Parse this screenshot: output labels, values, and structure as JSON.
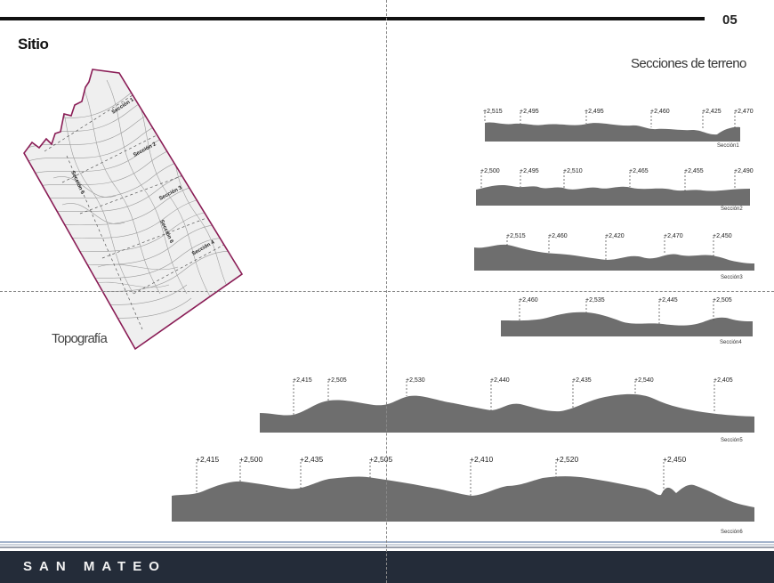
{
  "page_number": "05",
  "title": "Sitio",
  "sections_title": "Secciones de terreno",
  "topography_label": "Topografía",
  "footer": {
    "brand": "SAN MATEO",
    "color": "#242c39"
  },
  "colors": {
    "profile_fill": "#6e6e6e",
    "map_border": "#8a1d56",
    "rule": "#111111"
  },
  "map": {
    "labels": [
      "Sección 1",
      "Sección 2",
      "Sección 3",
      "Sección 4",
      "Sección 5",
      "Sección 6"
    ]
  },
  "profiles": [
    {
      "name": "Sección1",
      "elevations": [
        "+2,515",
        "+2,495",
        "+2,495",
        "+2,460",
        "+2,425",
        "+2,470"
      ]
    },
    {
      "name": "Sección2",
      "elevations": [
        "+2,500",
        "+2,495",
        "+2,510",
        "+2,465",
        "+2,455",
        "+2,490"
      ]
    },
    {
      "name": "Sección3",
      "elevations": [
        "+2,515",
        "+2,460",
        "+2,420",
        "+2,470",
        "+2,450"
      ]
    },
    {
      "name": "Sección4",
      "elevations": [
        "+2,460",
        "+2,535",
        "+2,445",
        "+2,505"
      ]
    },
    {
      "name": "Sección5",
      "elevations": [
        "+2,415",
        "+2,505",
        "+2,530",
        "+2,440",
        "+2,435",
        "+2,540",
        "+2,405"
      ]
    },
    {
      "name": "Sección6",
      "elevations": [
        "+2,415",
        "+2,500",
        "+2,435",
        "+2,505",
        "+2,410",
        "+2,520",
        "+2,450"
      ]
    }
  ]
}
